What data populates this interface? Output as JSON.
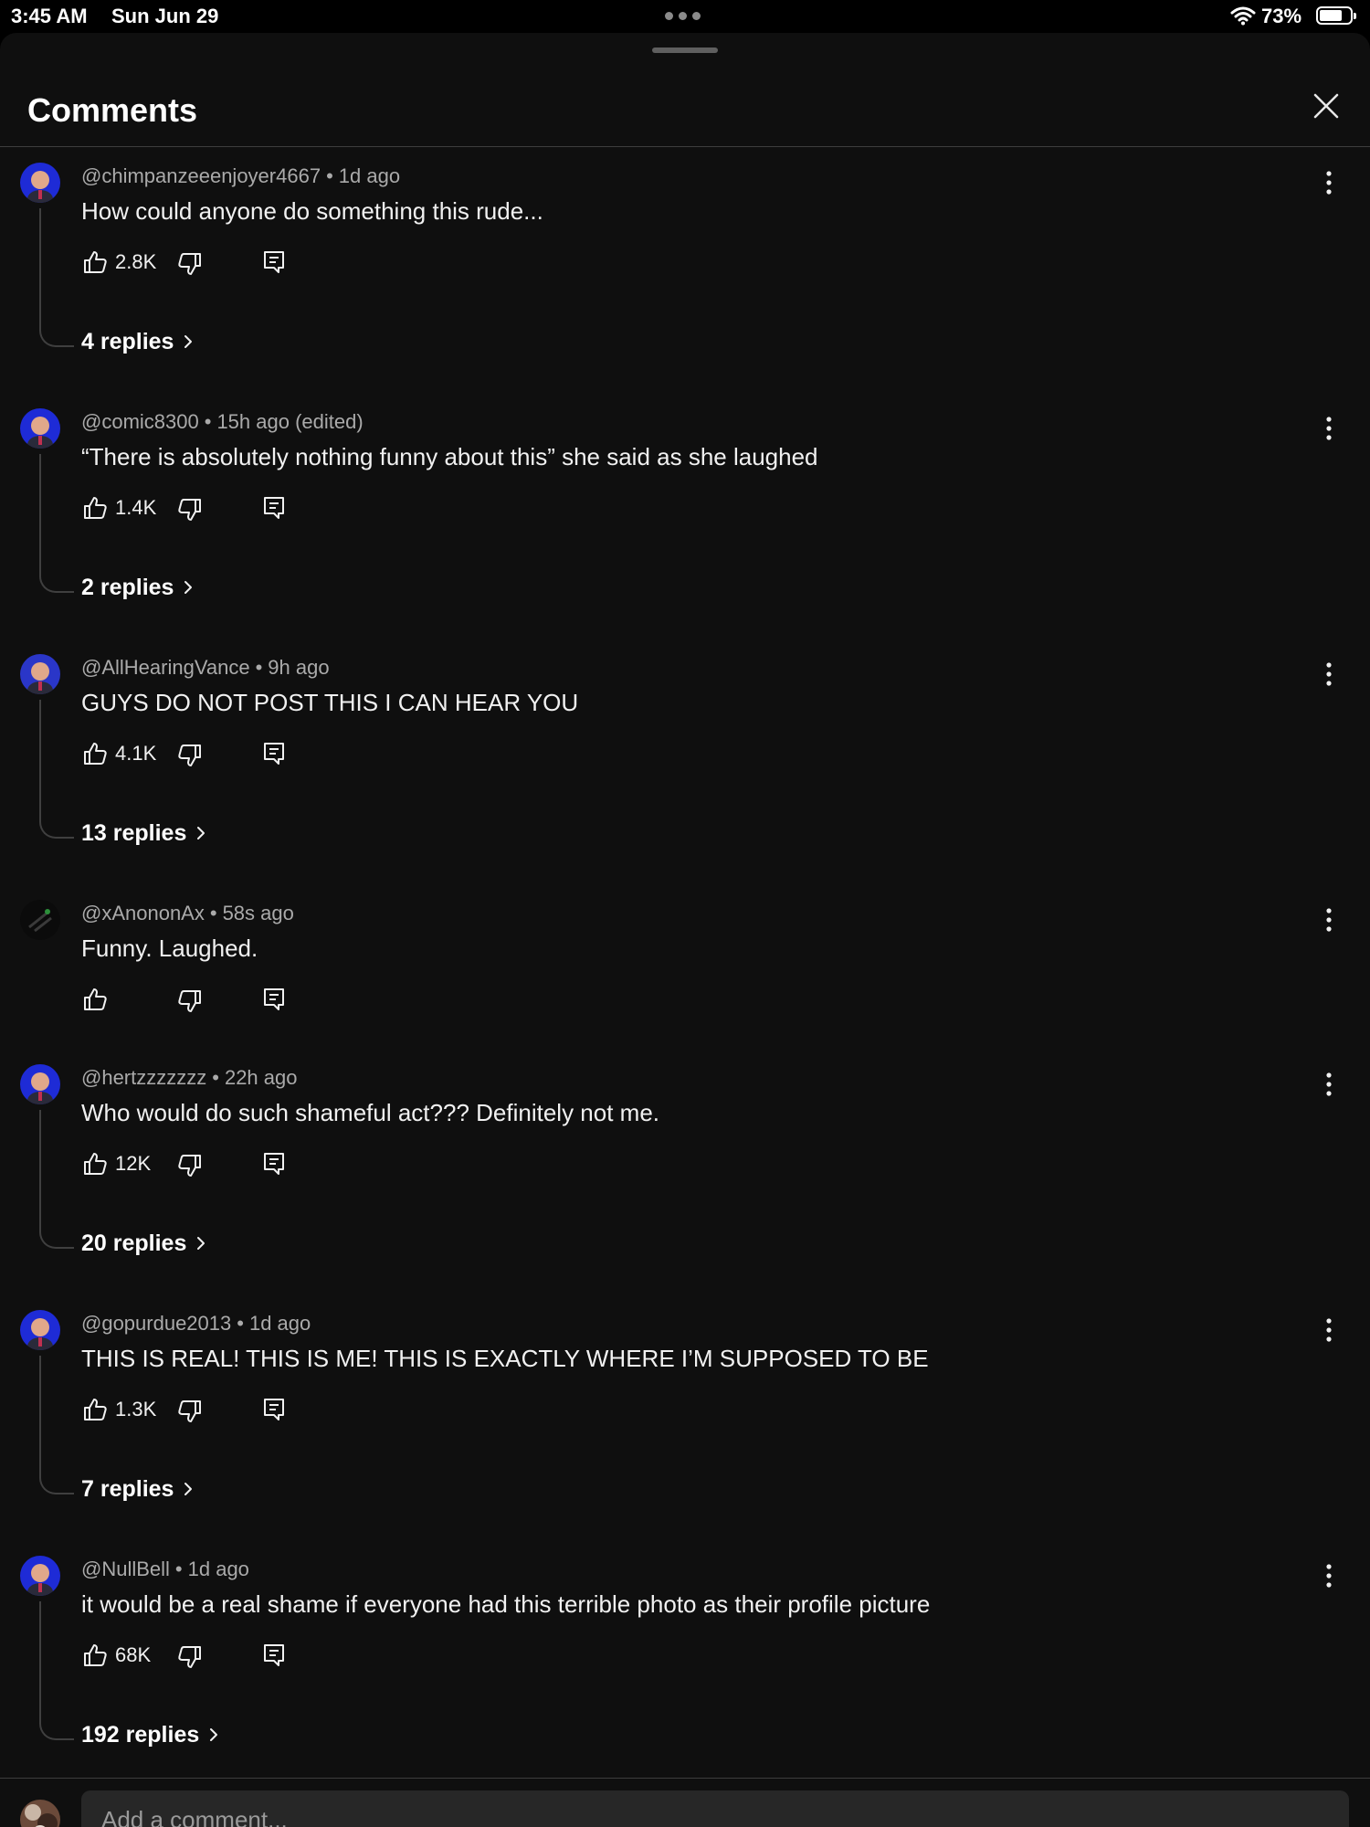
{
  "status_bar": {
    "time": "3:45 AM",
    "date": "Sun Jun 29",
    "battery": "73%"
  },
  "header": {
    "title": "Comments"
  },
  "comments": [
    {
      "author": "@chimpanzeeenjoyer4667",
      "age": "1d ago",
      "text": "How could anyone do something this rude...",
      "likes": "2.8K",
      "replies": "4 replies",
      "avatar_color": "#1e2bd6"
    },
    {
      "author": "@comic8300",
      "age": "15h ago (edited)",
      "text": "“There is absolutely nothing funny about this” she said as she laughed",
      "likes": "1.4K",
      "replies": "2 replies",
      "avatar_color": "#1e2bd6"
    },
    {
      "author": "@AllHearingVance",
      "age": "9h ago",
      "text": "GUYS DO NOT POST THIS I CAN HEAR YOU",
      "likes": "4.1K",
      "replies": "13 replies",
      "avatar_color": "#2a36c8"
    },
    {
      "author": "@xAnononAx",
      "age": "58s ago",
      "text": "Funny. Laughed.",
      "likes": "",
      "replies": "",
      "avatar_color": "#111111"
    },
    {
      "author": "@hertzzzzzzz",
      "age": "22h ago",
      "text": "Who would do such shameful act??? Definitely not me.",
      "likes": "12K",
      "replies": "20 replies",
      "avatar_color": "#1e2bd6"
    },
    {
      "author": "@gopurdue2013",
      "age": "1d ago",
      "text": "THIS IS REAL! THIS IS ME! THIS IS EXACTLY WHERE I’M SUPPOSED TO BE",
      "likes": "1.3K",
      "replies": "7 replies",
      "avatar_color": "#1e2bd6"
    },
    {
      "author": "@NullBell",
      "age": "1d ago",
      "text": "it would be a real shame if everyone had this terrible photo as their profile picture",
      "likes": "68K",
      "replies": "192 replies",
      "avatar_color": "#1e2bd6"
    }
  ],
  "composer": {
    "placeholder": "Add a comment..."
  },
  "colors": {
    "background": "#0f0f0f",
    "text": "#f1f1f1",
    "muted": "#aaaaaa",
    "input": "#272727"
  },
  "icons": [
    "wifi-icon",
    "battery-icon",
    "close-icon",
    "more-vertical-icon",
    "thumbs-up-icon",
    "thumbs-down-icon",
    "reply-icon",
    "chevron-right-icon"
  ]
}
